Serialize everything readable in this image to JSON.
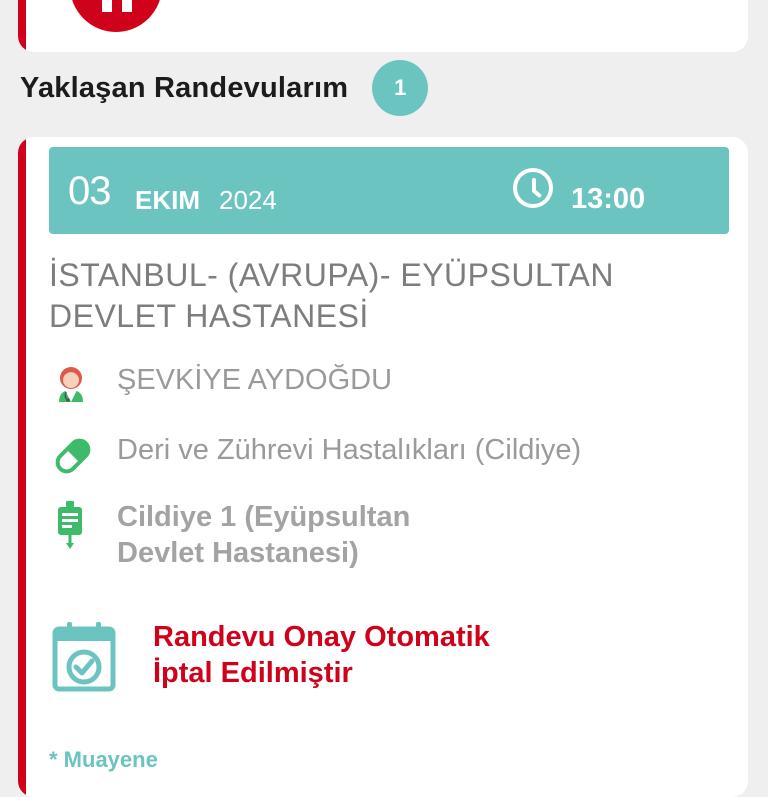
{
  "section": {
    "title": "Yaklaşan Randevularım",
    "count": "1"
  },
  "appointment": {
    "date_day": "03",
    "date_month": "EKIM",
    "date_year": "2024",
    "time": "13:00",
    "hospital": "İSTANBUL- (AVRUPA)- EYÜPSULTAN DEVLET HASTANESİ",
    "doctor": "ŞEVKİYE AYDOĞDU",
    "department": "Deri ve Zührevi Hastalıkları (Cildiye)",
    "clinic_line1": "Cildiye 1 (Eyüpsultan",
    "clinic_line2": "Devlet Hastanesi)",
    "status_line1": "Randevu Onay Otomatik",
    "status_line2": "İptal Edilmiştir",
    "footnote": "* Muayene"
  },
  "colors": {
    "brand_red": "#d0021b",
    "teal": "#6cc4c0",
    "icon_green": "#3dbb6a"
  },
  "icons": [
    "hospital-logo-icon",
    "clock-icon",
    "doctor-icon",
    "pill-icon",
    "clinic-icon",
    "calendar-check-icon"
  ]
}
